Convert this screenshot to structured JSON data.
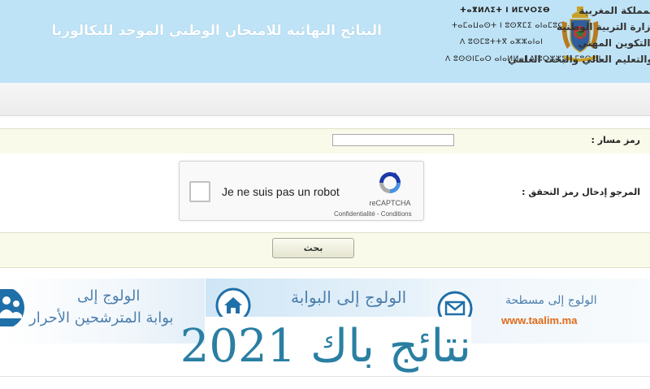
{
  "header": {
    "title": "النتائج النهائية للامتحان الوطني الموحد للبكالوريا",
    "tifinagh_lines": [
      "ⵜⴰⴳⵍⴷⵉⵜ ⵏ ⵍⵎⵖⵔⵉⴱ",
      "ⵜⴰⵎⴰⵡⴰⵙⵜ ⵏ ⵓⵙⴳⵎⵉ ⴰⵏⴰⵎⵓⵔ",
      "ⴷ ⵓⵙⵎⵓⵜⵜⴳ ⴰⵣⵣⴰⵏⴰⵏ",
      "ⴷ ⵓⵙⵙⵏⵎⴰⵔ ⴰⵏⴰⵍⵍⴰⵏ ⴷ ⵓⵔⵣⵣⵓ ⴰⵎⵓⵙⵙⵏ"
    ],
    "ministry_lines": [
      "المملكة المغربية",
      "وزارة التربية الوطنية",
      "والتكوين المهني",
      "والتعليم العالي والبحث العلمي"
    ]
  },
  "form": {
    "massar_label": "رمز مسار :",
    "massar_value": "",
    "captcha_label": "المرجو إدخال رمز التحقق :",
    "search_button": "بحث"
  },
  "recaptcha": {
    "label": "Je ne suis pas un robot",
    "brand": "reCAPTCHA",
    "links": "Confidentialité - Conditions"
  },
  "banners": {
    "left_line1": "الولوج إلى",
    "left_line2": "بوابة المترشحين الأحرار",
    "mid_line1": "الولوج إلى البوابة",
    "right_line1": "الولوج إلى مسطحة",
    "right_url": "www.taalim.ma"
  },
  "overlay": {
    "text": "نتائج باك 2021"
  },
  "icons": {
    "emblem": "coat-of-arms-icon",
    "people": "people-icon",
    "home": "home-icon",
    "mail": "mail-icon",
    "recaptcha": "recaptcha-logo-icon"
  },
  "colors": {
    "header_bg": "#bfe3f6",
    "banner_text": "#4d7fae",
    "overlay_text": "#2a7fa2",
    "url": "#e06a18",
    "form_row_bg": "#fafaea"
  }
}
